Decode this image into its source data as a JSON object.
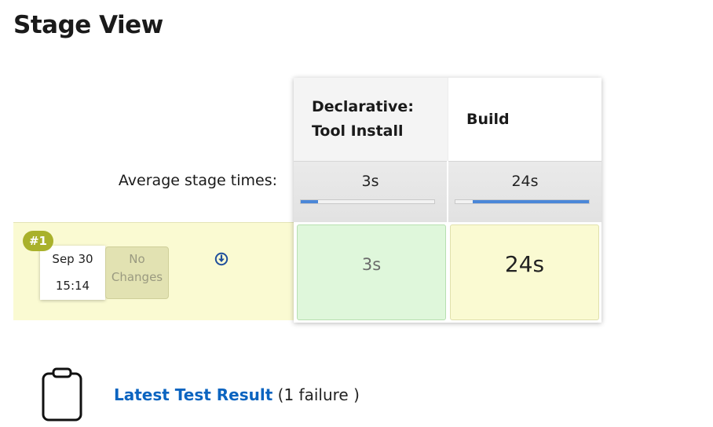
{
  "page": {
    "title": "Stage View"
  },
  "stages": [
    {
      "name": "Declarative: Tool Install",
      "avg_time": "3s",
      "avg_fraction": 0.13,
      "run_time": "3s",
      "status": "success"
    },
    {
      "name": "Build",
      "avg_time": "24s",
      "avg_fraction": 0.87,
      "run_time": "24s",
      "status": "unstable"
    }
  ],
  "avg_label": "Average stage times:",
  "run": {
    "badge": "#1",
    "date": "Sep 30",
    "time": "15:14",
    "changes_line1": "No",
    "changes_line2": "Changes",
    "download_icon": "circle-arrow-down-icon"
  },
  "test_result": {
    "icon": "clipboard-icon",
    "link": "Latest Test Result",
    "summary": "(1 failure )"
  },
  "colors": {
    "success": "#dff7db",
    "unstable": "#fafad2",
    "progress": "#4b87d8",
    "badge": "#a9b12b",
    "link": "#0b64c0"
  }
}
